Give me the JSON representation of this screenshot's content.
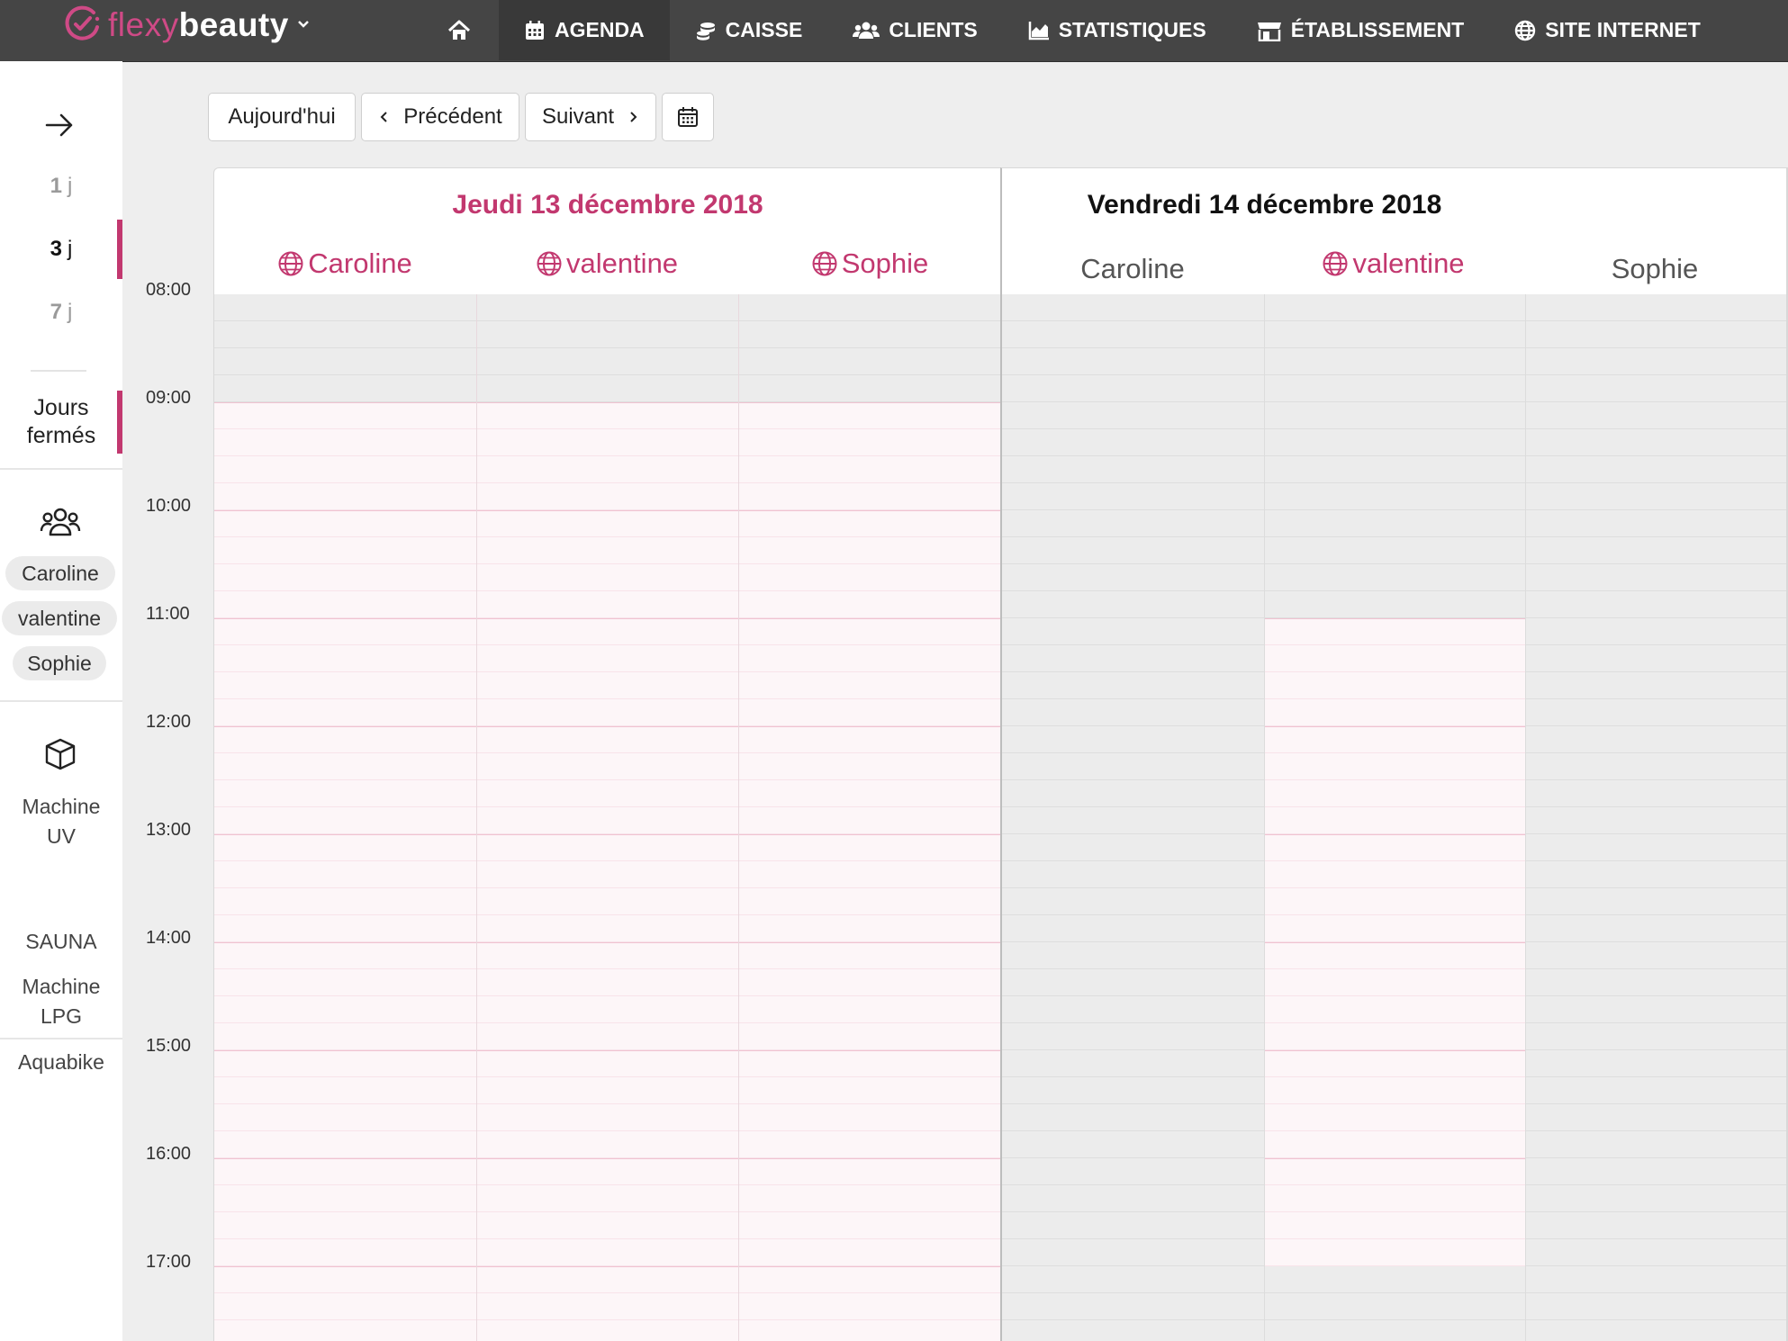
{
  "brand": {
    "part1": "flexy",
    "part2": "beauty"
  },
  "nav": [
    {
      "label": "",
      "icon": "home-icon"
    },
    {
      "label": "AGENDA",
      "icon": "calendar-icon"
    },
    {
      "label": "CAISSE",
      "icon": "coins-icon"
    },
    {
      "label": "CLIENTS",
      "icon": "users-icon"
    },
    {
      "label": "STATISTIQUES",
      "icon": "chart-icon"
    },
    {
      "label": "ÉTABLISSEMENT",
      "icon": "store-icon"
    },
    {
      "label": "SITE INTERNET",
      "icon": "globe-icon"
    }
  ],
  "sidebar": {
    "views": [
      {
        "num": "1",
        "unit": "j"
      },
      {
        "num": "3",
        "unit": "j"
      },
      {
        "num": "7",
        "unit": "j"
      }
    ],
    "closed_days": "Jours fermés",
    "staff": [
      "Caroline",
      "valentine",
      "Sophie"
    ],
    "resources": [
      "Machine UV",
      "SAUNA",
      "Machine LPG",
      "Aquabike"
    ]
  },
  "toolbar": {
    "today": "Aujourd'hui",
    "previous": "Précédent",
    "next": "Suivant"
  },
  "calendar": {
    "days": [
      {
        "title": "Jeudi 13 décembre 2018",
        "staff": [
          "Caroline",
          "valentine",
          "Sophie"
        ]
      },
      {
        "title": "Vendredi 14 décembre 2018",
        "staff": [
          "Caroline",
          "valentine",
          "Sophie"
        ]
      }
    ],
    "hours": [
      "08:00",
      "09:00",
      "10:00",
      "11:00",
      "12:00",
      "13:00",
      "14:00",
      "15:00",
      "16:00",
      "17:00"
    ]
  },
  "colors": {
    "accent": "#c2386f",
    "topbar": "#454545"
  }
}
